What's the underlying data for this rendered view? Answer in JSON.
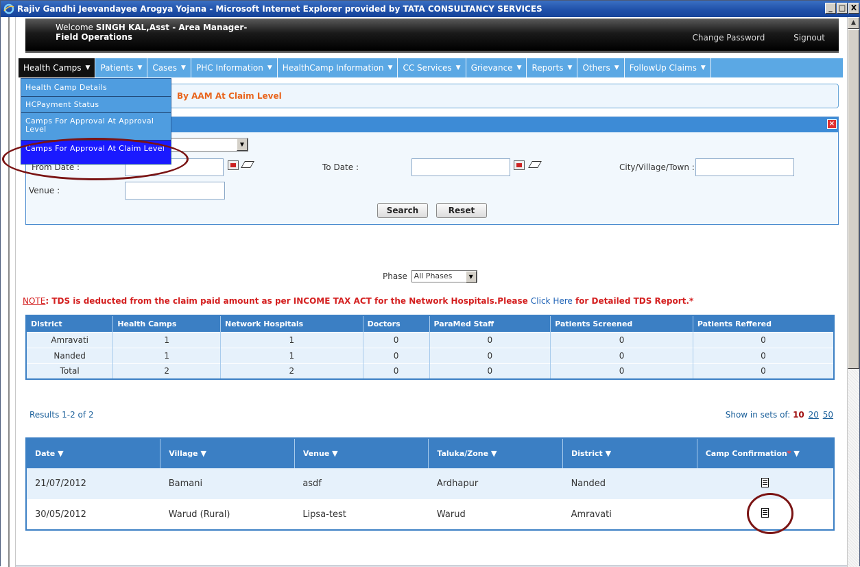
{
  "window": {
    "title": "Rajiv Gandhi Jeevandayee Arogya Yojana - Microsoft Internet Explorer provided by TATA CONSULTANCY SERVICES",
    "min": "_",
    "max": "□",
    "close": "X"
  },
  "header": {
    "welcome_prefix": "Welcome ",
    "user": "SINGH KAL,Asst - Area Manager-",
    "dept": "Field Operations",
    "change_password": "Change Password",
    "signout": "Signout"
  },
  "menu": [
    {
      "label": "Health Camps"
    },
    {
      "label": "Patients"
    },
    {
      "label": "Cases"
    },
    {
      "label": "PHC Information"
    },
    {
      "label": "HealthCamp Information"
    },
    {
      "label": "CC Services"
    },
    {
      "label": "Grievance"
    },
    {
      "label": "Reports"
    },
    {
      "label": "Others"
    },
    {
      "label": "FollowUp Claims"
    }
  ],
  "dropdown": [
    "Health Camp Details",
    "HCPayment Status",
    "Camps For Approval At Approval Level",
    "Camps For Approval At Claim Level"
  ],
  "subtitle": "By AAM At Claim Level",
  "search": {
    "from_date_label": "From Date :",
    "to_date_label": "To Date :",
    "city_label": "City/Village/Town :",
    "venue_label": "Venue :",
    "search_btn": "Search",
    "reset_btn": "Reset"
  },
  "phase": {
    "label": "Phase",
    "value": "All Phases"
  },
  "note": {
    "prefix": "NOTE",
    "text": ": TDS is deducted from the claim paid amount as per INCOME TAX ACT for the Network Hospitals.Please ",
    "link": "Click Here",
    "suffix": " for Detailed TDS Report.",
    "star": "*"
  },
  "summary": {
    "headers": [
      "District",
      "Health Camps",
      "Network Hospitals",
      "Doctors",
      "ParaMed Staff",
      "Patients Screened",
      "Patients Reffered"
    ],
    "rows": [
      [
        "Amravati",
        "1",
        "1",
        "0",
        "0",
        "0",
        "0"
      ],
      [
        "Nanded",
        "1",
        "1",
        "0",
        "0",
        "0",
        "0"
      ],
      [
        "Total",
        "2",
        "2",
        "0",
        "0",
        "0",
        "0"
      ]
    ]
  },
  "results": {
    "info": "Results 1-2 of 2",
    "show_label": "Show in sets of: ",
    "current": "10",
    "opt20": "20",
    "opt50": "50"
  },
  "camps": {
    "headers": [
      "Date",
      "Village",
      "Venue",
      "Taluka/Zone",
      "District",
      "Camp Confirmation"
    ],
    "rows": [
      [
        "21/07/2012",
        "Bamani",
        "asdf",
        "Ardhapur",
        "Nanded"
      ],
      [
        "30/05/2012",
        "Warud (Rural)",
        "Lipsa-test",
        "Warud",
        "Amravati"
      ]
    ]
  }
}
